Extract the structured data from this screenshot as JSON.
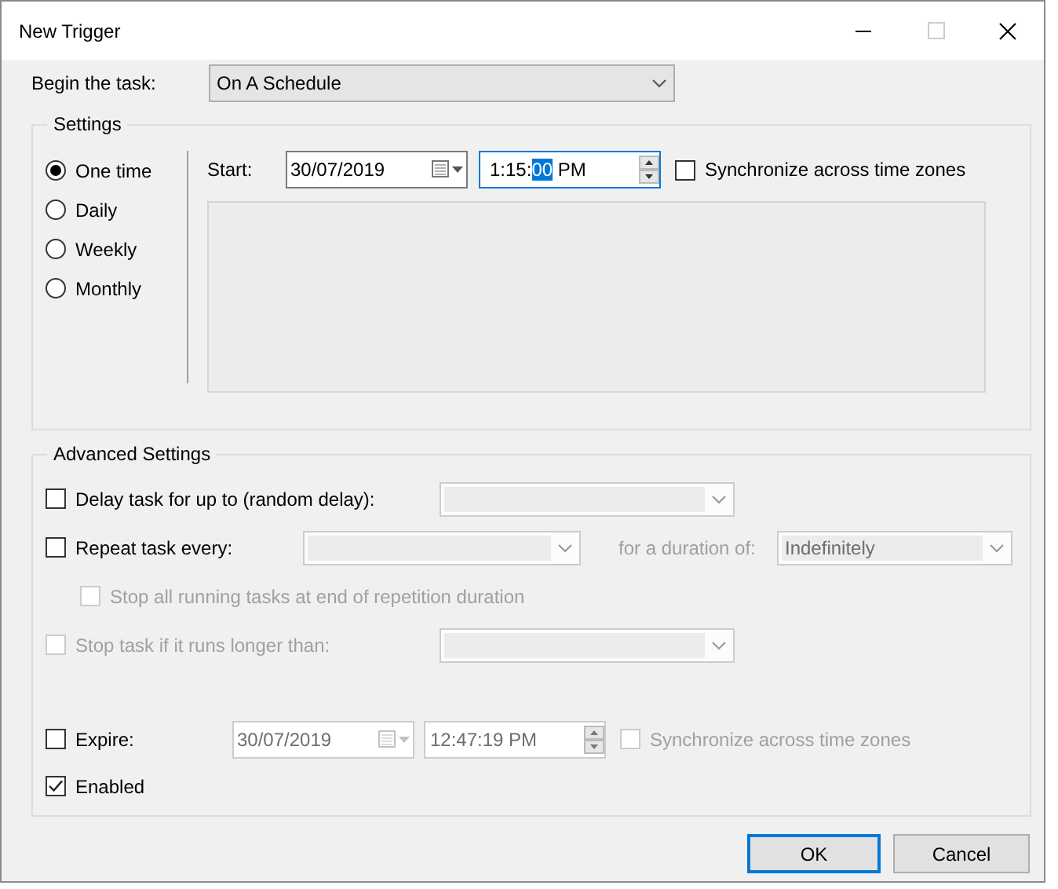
{
  "window": {
    "title": "New Trigger"
  },
  "begin_task": {
    "label": "Begin the task:",
    "value": "On A Schedule"
  },
  "settings": {
    "title": "Settings",
    "schedules": [
      {
        "label": "One time",
        "selected": true
      },
      {
        "label": "Daily",
        "selected": false
      },
      {
        "label": "Weekly",
        "selected": false
      },
      {
        "label": "Monthly",
        "selected": false
      }
    ],
    "start": {
      "label": "Start:",
      "date": "30/07/2019",
      "time": [
        {
          "text": "1:15:",
          "selected": false
        },
        {
          "text": "00",
          "selected": true
        },
        {
          "text": " PM",
          "selected": false
        }
      ]
    },
    "sync": {
      "label": "Synchronize across time zones",
      "checked": false,
      "disabled": false
    }
  },
  "advanced": {
    "title": "Advanced Settings",
    "delay": {
      "label": "Delay task for up to (random delay):",
      "checked": false,
      "dropdown_disabled": true
    },
    "repeat": {
      "label": "Repeat task every:",
      "checked": false,
      "dropdown_disabled": true
    },
    "duration": {
      "label": "for a duration of:",
      "value": "Indefinitely",
      "disabled": true
    },
    "stop_all": {
      "label": "Stop all running tasks at end of repetition duration",
      "checked": false,
      "disabled": true
    },
    "stop_long": {
      "label": "Stop task if it runs longer than:",
      "checked": false,
      "disabled": true
    },
    "expire": {
      "label": "Expire:",
      "checked": false,
      "date": "30/07/2019",
      "time": "12:47:19 PM",
      "disabled": true,
      "sync": {
        "label": "Synchronize across time zones",
        "checked": false,
        "disabled": true
      }
    },
    "enabled": {
      "label": "Enabled",
      "checked": true
    }
  },
  "buttons": [
    {
      "label": "OK",
      "default": true
    },
    {
      "label": "Cancel",
      "default": false
    }
  ]
}
